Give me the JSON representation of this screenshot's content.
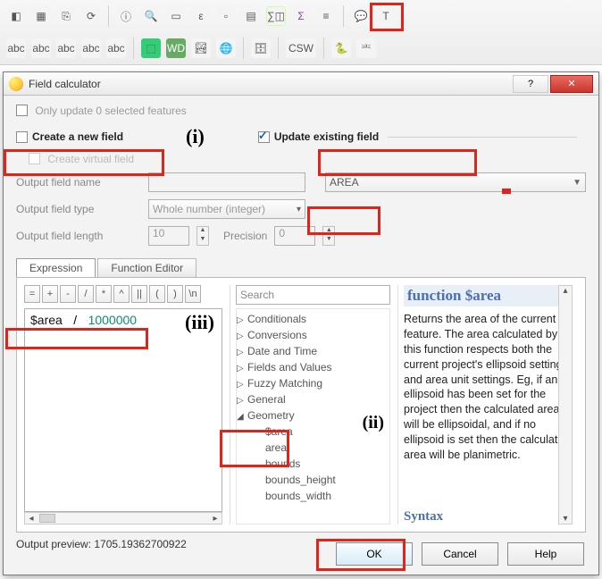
{
  "toolbar": {
    "highlight_icon": "field-calculator-icon"
  },
  "window": {
    "title": "Field calculator",
    "help_icon": "?",
    "close_icon": "✕"
  },
  "form": {
    "only_update_label": "Only update 0 selected features",
    "create_new_label": "Create a new field",
    "roman_i": "(i)",
    "update_existing_label": "Update existing field",
    "update_existing_checked": true,
    "create_virtual_label": "Create virtual field",
    "output_name_label": "Output field name",
    "output_type_label": "Output field type",
    "output_type_value": "Whole number (integer)",
    "output_length_label": "Output field length",
    "output_length_value": "10",
    "precision_label": "Precision",
    "precision_value": "0",
    "area_select": "AREA"
  },
  "tabs": {
    "expression": "Expression",
    "func_editor": "Function Editor"
  },
  "operators": [
    "=",
    "+",
    "-",
    "/",
    "*",
    "^",
    "||",
    "(",
    ")",
    "\\n"
  ],
  "expression": {
    "raw": "$area / 1000000",
    "var": "$area",
    "op": "/",
    "num": "1000000"
  },
  "roman_iii": "(iii)",
  "search": {
    "placeholder": "Search"
  },
  "tree": {
    "items": [
      {
        "label": "Conditionals",
        "expanded": false
      },
      {
        "label": "Conversions",
        "expanded": false
      },
      {
        "label": "Date and Time",
        "expanded": false
      },
      {
        "label": "Fields and Values",
        "expanded": false
      },
      {
        "label": "Fuzzy Matching",
        "expanded": false
      },
      {
        "label": "General",
        "expanded": false
      },
      {
        "label": "Geometry",
        "expanded": true,
        "children": [
          "$area",
          "area",
          "bounds",
          "bounds_height",
          "bounds_width"
        ]
      }
    ]
  },
  "roman_ii": "(ii)",
  "help": {
    "title": "function $area",
    "body": "Returns the area of the current feature. The area calculated by this function respects both the current project's ellipsoid setting and area unit settings. Eg, if an ellipsoid has been set for the project then the calculated area will be ellipsoidal, and if no ellipsoid is set then the calculated area will be planimetric.",
    "syntax_label": "Syntax"
  },
  "preview": {
    "label": "Output preview:  ",
    "value": "1705.19362700922"
  },
  "buttons": {
    "ok": "OK",
    "cancel": "Cancel",
    "help": "Help"
  }
}
